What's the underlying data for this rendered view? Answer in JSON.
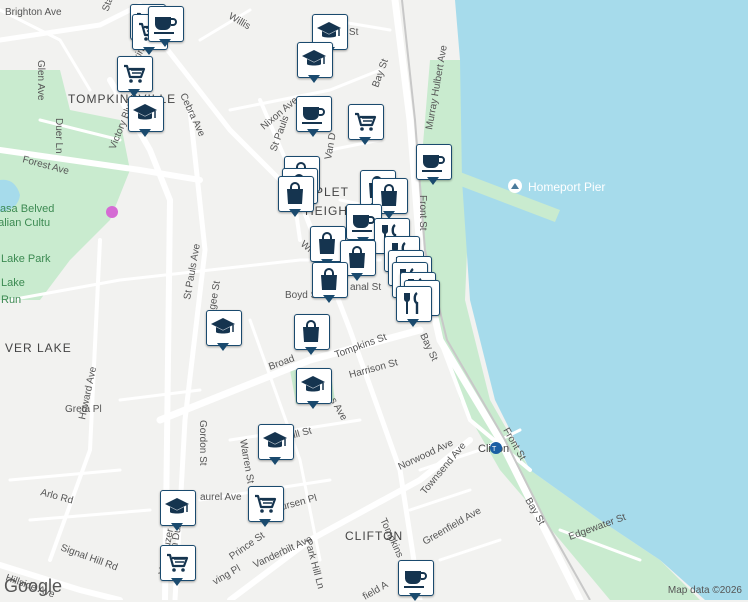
{
  "streets": [
    {
      "text": "Brighton Ave"
    },
    {
      "text": "Stanley"
    },
    {
      "text": "Glen Ave"
    },
    {
      "text": "Willis"
    },
    {
      "text": "Tompkins"
    },
    {
      "text": "Duer Ln"
    },
    {
      "text": "Cebra Ave"
    },
    {
      "text": "Victory Blvd"
    },
    {
      "text": "Forest Ave"
    },
    {
      "text": "Nixon Ave"
    },
    {
      "text": "St Pauls"
    },
    {
      "text": "Van D"
    },
    {
      "text": "Bay St"
    },
    {
      "text": "Murray Hulbert Ave"
    },
    {
      "text": "Front St"
    },
    {
      "text": "van St"
    },
    {
      "text": "Wrigh"
    },
    {
      "text": "Boyd S"
    },
    {
      "text": "anal St"
    },
    {
      "text": "Bay St"
    },
    {
      "text": "Broad"
    },
    {
      "text": "Tompkins St"
    },
    {
      "text": "Harrison St"
    },
    {
      "text": "Howard Ave"
    },
    {
      "text": "St Pauls Ave"
    },
    {
      "text": "Van Duzer St"
    },
    {
      "text": "gee St"
    },
    {
      "text": "Greta Pl"
    },
    {
      "text": "Gordon St"
    },
    {
      "text": "Warren St"
    },
    {
      "text": "Hill St"
    },
    {
      "text": "s Ave"
    },
    {
      "text": "Norwood Ave"
    },
    {
      "text": "Townsend Ave"
    },
    {
      "text": "Front St"
    },
    {
      "text": "Arlo Rd"
    },
    {
      "text": "aurel Ave"
    },
    {
      "text": "ursen Pl"
    },
    {
      "text": "Signal Hill Rd"
    },
    {
      "text": "Vanderbilt Ave"
    },
    {
      "text": "Tompkins"
    },
    {
      "text": "Greenfield Ave"
    },
    {
      "text": "Bay St"
    },
    {
      "text": "Edgewater St"
    },
    {
      "text": "Prince St"
    },
    {
      "text": "Park Hill Ln"
    },
    {
      "text": "ving Pl"
    },
    {
      "text": "Hillside Ave"
    },
    {
      "text": "field A"
    },
    {
      "text": "Van Duzer St"
    }
  ],
  "areas": [
    {
      "text": "TOMPKINSVILLE"
    },
    {
      "text": "PLET"
    },
    {
      "text": "HEIGH"
    },
    {
      "text": "VER LAKE"
    },
    {
      "text": "CLIFTON"
    }
  ],
  "parks": [
    {
      "text": "Casa Belved"
    },
    {
      "text": "Italian Cultu"
    },
    {
      "text": "Lake Park"
    },
    {
      "text": "Lake"
    },
    {
      "text": "Run"
    }
  ],
  "pois": [
    {
      "text": "Homeport Pier"
    },
    {
      "text": "Clifton"
    }
  ],
  "attribution": "Map data ©2026",
  "logo": "Google",
  "colors": {
    "water": "#a6dbeb",
    "park": "#c9ebcf",
    "road": "#ffffff",
    "marker_border": "#1a4a6e",
    "icon": "#15344f"
  }
}
